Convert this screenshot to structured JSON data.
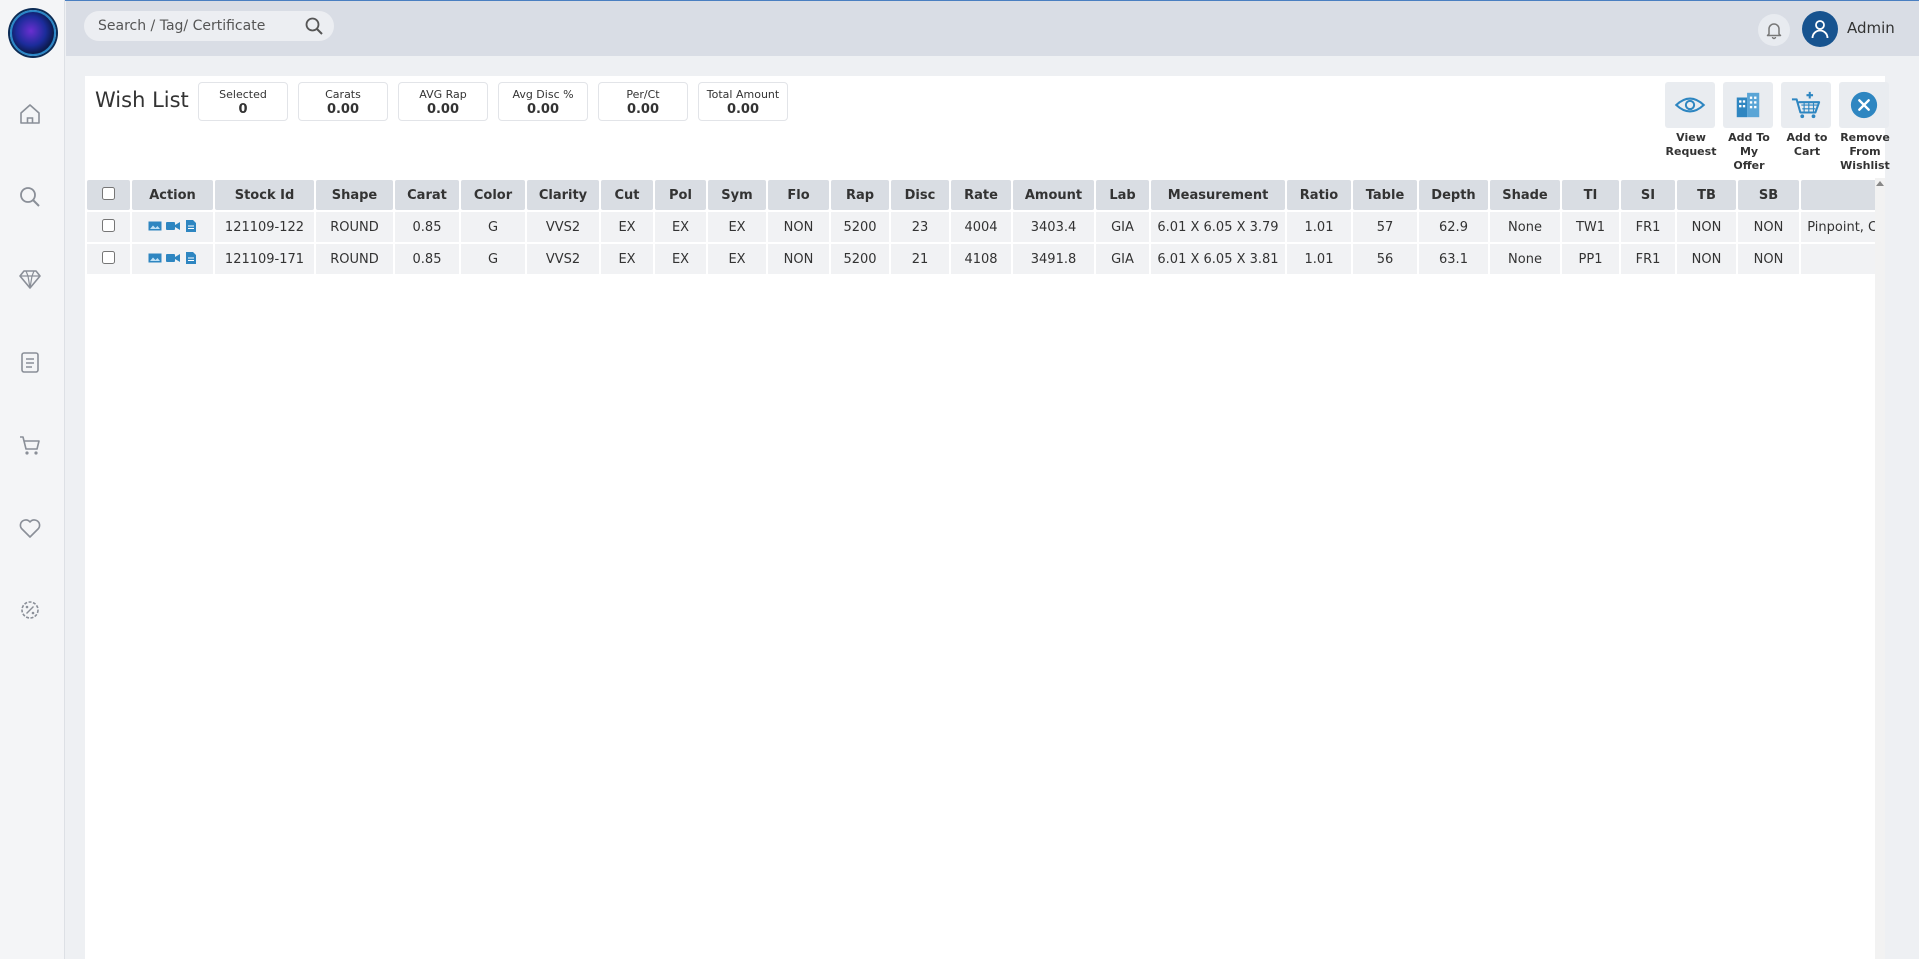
{
  "search": {
    "placeholder": "Search / Tag/ Certificate"
  },
  "user": {
    "name": "Admin"
  },
  "page": {
    "title": "Wish List"
  },
  "stats": [
    {
      "label": "Selected",
      "value": "0"
    },
    {
      "label": "Carats",
      "value": "0.00"
    },
    {
      "label": "AVG Rap",
      "value": "0.00"
    },
    {
      "label": "Avg Disc %",
      "value": "0.00"
    },
    {
      "label": "Per/Ct",
      "value": "0.00"
    },
    {
      "label": "Total Amount",
      "value": "0.00"
    }
  ],
  "actions": {
    "view_request": "View\nRequest",
    "add_to_offer": "Add To\nMy Offer",
    "add_to_cart": "Add to\nCart",
    "remove": "Remove\nFrom\nWishlist"
  },
  "icons": {
    "sidebar": [
      "home-icon",
      "search-icon",
      "diamond-icon",
      "clipboard-icon",
      "cart-icon",
      "heart-icon",
      "percent-icon"
    ]
  },
  "colors": {
    "accent": "#2e86c1",
    "header_bg": "#d9dde5",
    "avatar": "#17538f"
  },
  "table": {
    "columns": [
      "Action",
      "Stock Id",
      "Shape",
      "Carat",
      "Color",
      "Clarity",
      "Cut",
      "Pol",
      "Sym",
      "Flo",
      "Rap",
      "Disc",
      "Rate",
      "Amount",
      "Lab",
      "Measurement",
      "Ratio",
      "Table",
      "Depth",
      "Shade",
      "TI",
      "SI",
      "TB",
      "SB",
      ""
    ],
    "rows": [
      [
        "121109-122",
        "ROUND",
        "0.85",
        "G",
        "VVS2",
        "EX",
        "EX",
        "EX",
        "NON",
        "5200",
        "23",
        "4004",
        "3403.4",
        "GIA",
        "6.01 X 6.05 X 3.79",
        "1.01",
        "57",
        "62.9",
        "None",
        "TW1",
        "FR1",
        "NON",
        "NON",
        "Pinpoint, Cl"
      ],
      [
        "121109-171",
        "ROUND",
        "0.85",
        "G",
        "VVS2",
        "EX",
        "EX",
        "EX",
        "NON",
        "5200",
        "21",
        "4108",
        "3491.8",
        "GIA",
        "6.01 X 6.05 X 3.81",
        "1.01",
        "56",
        "63.1",
        "None",
        "PP1",
        "FR1",
        "NON",
        "NON",
        ""
      ]
    ]
  }
}
